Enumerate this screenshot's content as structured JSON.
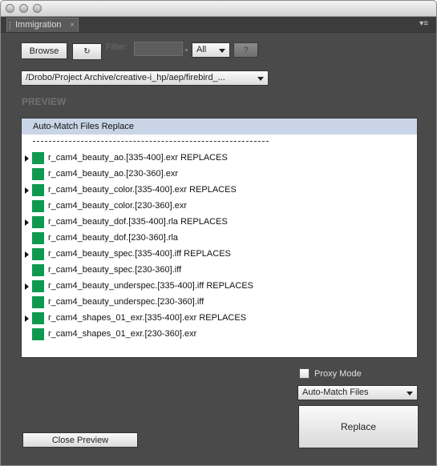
{
  "panel": {
    "tab_label": "Immigration",
    "close_glyph": "×",
    "menu_glyph": "▾≡"
  },
  "toolbar": {
    "browse_label": "Browse",
    "refresh_label": "↻",
    "filter_label": "Filter:",
    "filter_value": "",
    "type_select": "All",
    "help_label": "?"
  },
  "path": {
    "value": "/Drobo/Project Archive/creative-i_hp/aep/firebird_..."
  },
  "preview": {
    "section_title": "PREVIEW",
    "header": "Auto-Match Files Replace",
    "separator": "--------------------------------------------",
    "items": [
      {
        "name": "r_cam4_beauty_ao.[335-400].exr REPLACES",
        "expandable": true
      },
      {
        "name": "r_cam4_beauty_ao.[230-360].exr",
        "expandable": false
      },
      {
        "name": "r_cam4_beauty_color.[335-400].exr REPLACES",
        "expandable": true
      },
      {
        "name": "r_cam4_beauty_color.[230-360].exr",
        "expandable": false
      },
      {
        "name": "r_cam4_beauty_dof.[335-400].rla REPLACES",
        "expandable": true
      },
      {
        "name": "r_cam4_beauty_dof.[230-360].rla",
        "expandable": false
      },
      {
        "name": "r_cam4_beauty_spec.[335-400].iff REPLACES",
        "expandable": true
      },
      {
        "name": "r_cam4_beauty_spec.[230-360].iff",
        "expandable": false
      },
      {
        "name": "r_cam4_beauty_underspec.[335-400].iff REPLACES",
        "expandable": true
      },
      {
        "name": "r_cam4_beauty_underspec.[230-360].iff",
        "expandable": false
      },
      {
        "name": "r_cam4_shapes_01_exr.[335-400].exr REPLACES",
        "expandable": true
      },
      {
        "name": "r_cam4_shapes_01_exr.[230-360].exr",
        "expandable": false
      }
    ]
  },
  "options": {
    "proxy_label": "Proxy Mode",
    "proxy_checked": false,
    "mode_select": "Auto-Match Files"
  },
  "actions": {
    "replace_label": "Replace",
    "close_preview_label": "Close Preview"
  },
  "colors": {
    "panel_bg": "#4a4a4a",
    "header_bg": "#c9d5e6",
    "swatch": "#0d9a4f"
  }
}
